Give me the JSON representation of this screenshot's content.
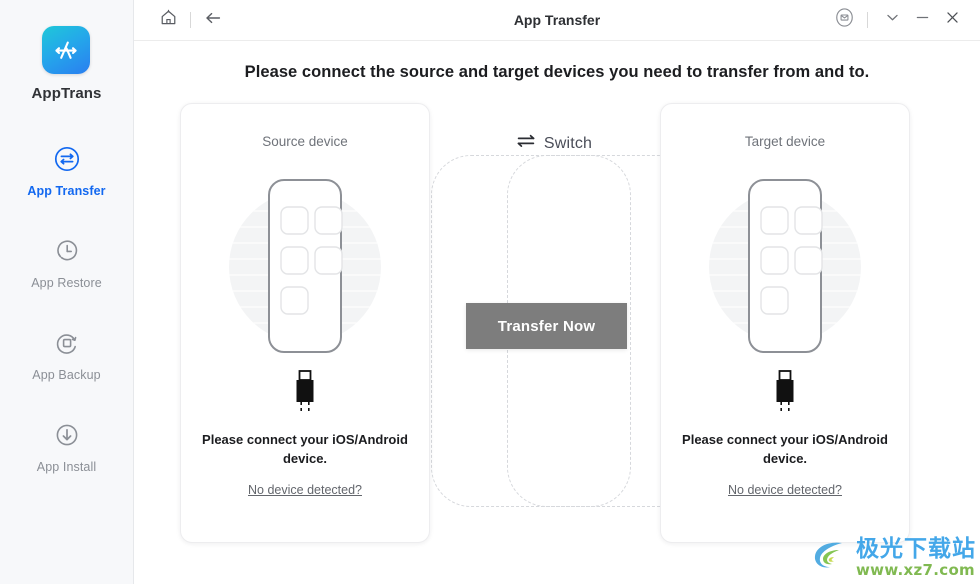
{
  "sidebar": {
    "brand": {
      "name": "AppTrans",
      "logo_icon": "apptrans-logo-icon",
      "gradient_from": "#1fc8d8",
      "gradient_to": "#2a7ef0"
    },
    "active_accent": "#1268f0",
    "items": [
      {
        "label": "App Transfer",
        "icon": "transfer-arrows-circle-icon",
        "active": true
      },
      {
        "label": "App Restore",
        "icon": "clock-restore-icon",
        "active": false
      },
      {
        "label": "App Backup",
        "icon": "backup-square-refresh-icon",
        "active": false
      },
      {
        "label": "App Install",
        "icon": "download-circle-icon",
        "active": false
      }
    ]
  },
  "titlebar": {
    "title": "App Transfer",
    "home_icon": "home-icon",
    "back_icon": "arrow-left-icon",
    "mail_icon": "envelope-circle-icon",
    "chevron_icon": "chevron-down-icon",
    "minimize_icon": "minimize-icon",
    "close_icon": "close-icon"
  },
  "main": {
    "headline": "Please connect the source and target devices you need to transfer from and to.",
    "switch": {
      "label": "Switch",
      "icon": "switch-arrows-icon"
    },
    "transfer_button": {
      "label": "Transfer Now",
      "color": "#7d7d7d",
      "enabled": false
    },
    "cards": [
      {
        "title": "Source device",
        "note": "Please connect your iOS/Android device.",
        "link": "No device detected?",
        "illustration_icon": "phone-apps-illustration-icon",
        "connector_icon": "usb-connector-icon"
      },
      {
        "title": "Target device",
        "note": "Please connect your iOS/Android device.",
        "link": "No device detected?",
        "illustration_icon": "phone-apps-illustration-icon",
        "connector_icon": "usb-connector-icon"
      }
    ]
  },
  "watermark": {
    "cn": "极光下载站",
    "url": "www.xz7.com",
    "logo_icon": "jiguang-swirl-logo-icon"
  }
}
